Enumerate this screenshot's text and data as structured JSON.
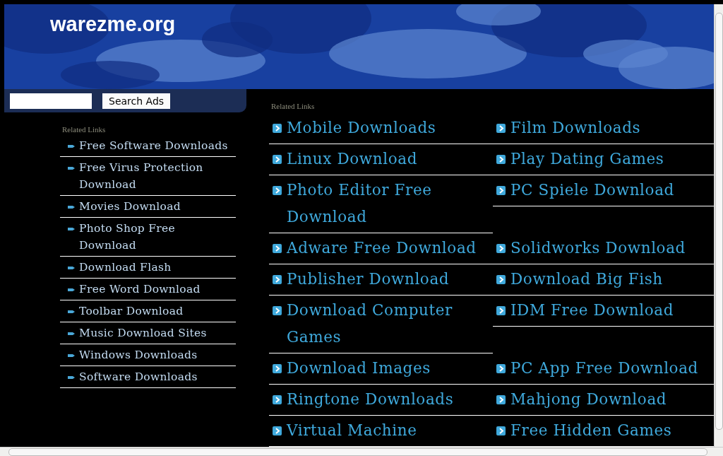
{
  "site_title": "warezme.org",
  "search": {
    "button": "Search Ads"
  },
  "sidebar": {
    "heading": "Related Links",
    "links": [
      "Free Software Downloads",
      "Free Virus Protection Download",
      "Movies Download",
      "Photo Shop Free Download",
      "Download Flash",
      "Free Word Download",
      "Toolbar Download",
      "Music Download Sites",
      "Windows Downloads",
      "Software Downloads"
    ]
  },
  "main": {
    "heading": "Related Links",
    "links": [
      "Mobile Downloads",
      "Film Downloads",
      "Linux Download",
      "Play Dating Games",
      "Photo Editor Free Download",
      "PC Spiele Download",
      "Adware Free Download",
      "Solidworks Download",
      "Publisher Download",
      "Download Big Fish",
      "Download Computer Games",
      "IDM Free Download",
      "Download Images",
      "PC App Free Download",
      "Ringtone Downloads",
      "Mahjong Download",
      "Virtual Machine",
      "Free Hidden Games"
    ]
  }
}
